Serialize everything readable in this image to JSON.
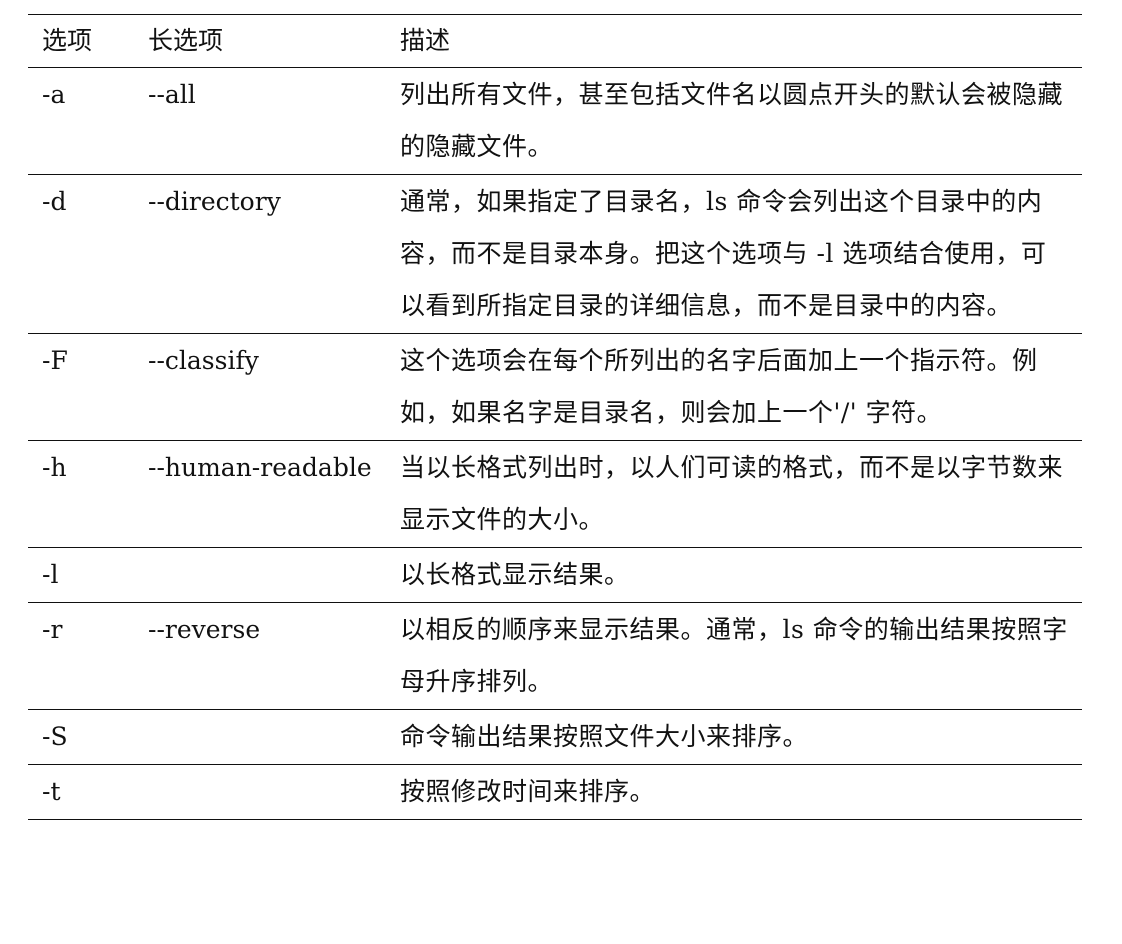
{
  "header": {
    "col_option": "选项",
    "col_long_option": "长选项",
    "col_description": "描述"
  },
  "rows": [
    {
      "option": "-a",
      "long_option": "--all",
      "description": "列出所有文件，甚至包括文件名以圆点开头的默认会被隐藏的隐藏文件。"
    },
    {
      "option": "-d",
      "long_option": "--directory",
      "description": "通常，如果指定了目录名，ls 命令会列出这个目录中的内容，而不是目录本身。把这个选项与 -l 选项结合使用，可以看到所指定目录的详细信息，而不是目录中的内容。"
    },
    {
      "option": "-F",
      "long_option": "--classify",
      "description": "这个选项会在每个所列出的名字后面加上一个指示符。例如，如果名字是目录名，则会加上一个'/' 字符。"
    },
    {
      "option": "-h",
      "long_option": "--human-readable",
      "description": "当以长格式列出时，以人们可读的格式，而不是以字节数来显示文件的大小。"
    },
    {
      "option": "-l",
      "long_option": "",
      "description": "以长格式显示结果。"
    },
    {
      "option": "-r",
      "long_option": "--reverse",
      "description": "以相反的顺序来显示结果。通常，ls 命令的输出结果按照字母升序排列。"
    },
    {
      "option": "-S",
      "long_option": "",
      "description": "命令输出结果按照文件大小来排序。"
    },
    {
      "option": "-t",
      "long_option": "",
      "description": "按照修改时间来排序。"
    }
  ]
}
